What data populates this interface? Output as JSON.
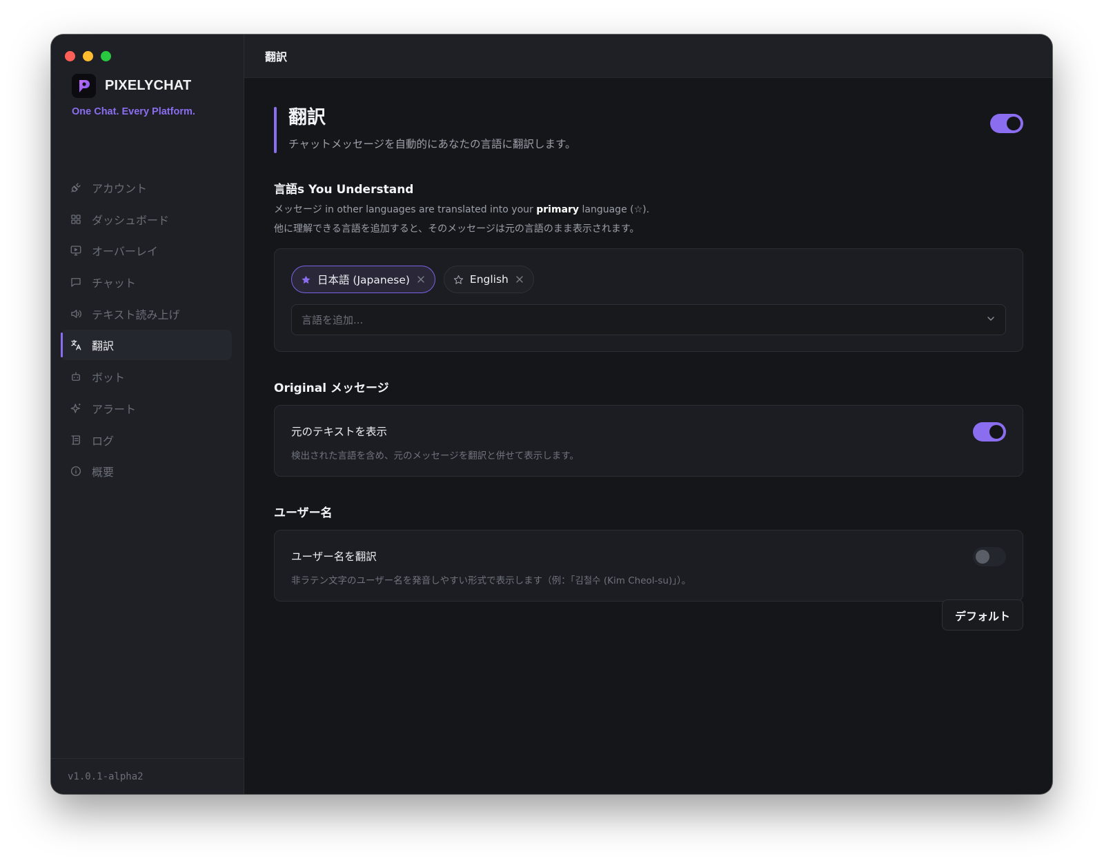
{
  "app": {
    "brand_name": "PIXELYCHAT",
    "tagline": "One Chat. Every Platform.",
    "version": "v1.0.1-alpha2",
    "accent_color": "#8b6ef0"
  },
  "sidebar": {
    "items": [
      {
        "label": "アカウント",
        "icon": "plug-icon",
        "active": false
      },
      {
        "label": "ダッシュボード",
        "icon": "dashboard-grid-icon",
        "active": false
      },
      {
        "label": "オーバーレイ",
        "icon": "monitor-icon",
        "active": false
      },
      {
        "label": "チャット",
        "icon": "chat-bubble-icon",
        "active": false
      },
      {
        "label": "テキスト読み上げ",
        "icon": "speaker-icon",
        "active": false
      },
      {
        "label": "翻訳",
        "icon": "translate-icon",
        "active": true
      },
      {
        "label": "ボット",
        "icon": "bot-icon",
        "active": false
      },
      {
        "label": "アラート",
        "icon": "sparkle-icon",
        "active": false
      },
      {
        "label": "ログ",
        "icon": "scroll-icon",
        "active": false
      },
      {
        "label": "概要",
        "icon": "info-icon",
        "active": false
      }
    ]
  },
  "header": {
    "title": "翻訳"
  },
  "hero": {
    "title": "翻訳",
    "description": "チャットメッセージを自動的にあなたの言語に翻訳します。",
    "enabled": true
  },
  "languages": {
    "title": "言語s You Understand",
    "desc_part1": "メッセージ in other languages are translated into your ",
    "desc_bold": "primary",
    "desc_part2": " language (☆).",
    "desc_line2": "他に理解できる言語を追加すると、そのメッセージは元の言語のまま表示されます。",
    "chips": [
      {
        "label": "日本語 (Japanese)",
        "primary": true
      },
      {
        "label": "English",
        "primary": false
      }
    ],
    "add_placeholder": "言語を追加..."
  },
  "original": {
    "title": "Original メッセージ",
    "setting_label": "元のテキストを表示",
    "setting_desc": "検出された言語を含め、元のメッセージを翻訳と併せて表示します。",
    "enabled": true
  },
  "usernames": {
    "title": "ユーザー名",
    "setting_label": "ユーザー名を翻訳",
    "setting_desc": "非ラテン文字のユーザー名を発音しやすい形式で表示します（例：「김철수 (Kim Cheol-su)」）。",
    "enabled": false
  },
  "actions": {
    "default_label": "デフォルト"
  }
}
